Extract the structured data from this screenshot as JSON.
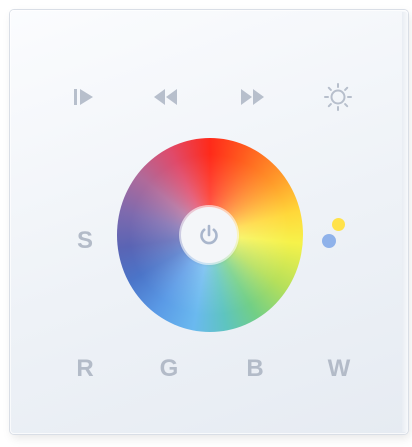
{
  "panel": {
    "buttons": {
      "play_icon": "play-icon",
      "prev_icon": "rewind-icon",
      "next_icon": "fast-forward-icon",
      "brightness_icon": "brightness-icon",
      "power_icon": "power-icon",
      "white_mode_icon": "white-balance-dots-icon"
    },
    "labels": {
      "speed": "S",
      "red": "R",
      "green": "G",
      "blue": "B",
      "white": "W"
    }
  },
  "colors": {
    "icon": "#b7bfcc",
    "panel": "#eef2f7",
    "dot_yellow": "#ffe24a",
    "dot_blue": "#8fb2ea"
  }
}
